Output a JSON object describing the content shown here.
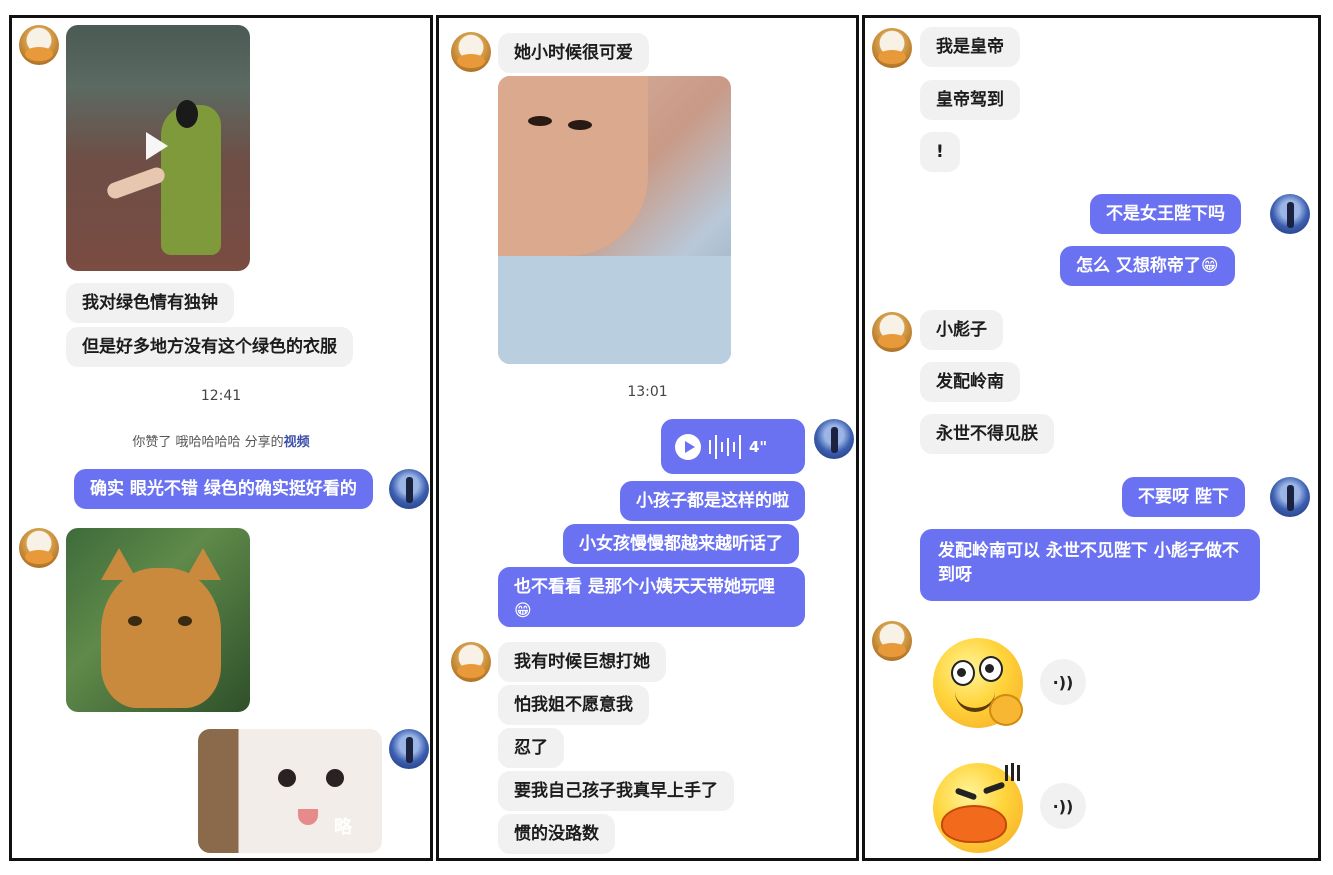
{
  "panel1": {
    "msg1": "我对绿色情有独钟",
    "msg2": "但是好多地方没有这个绿色的衣服",
    "time": "12:41",
    "sys_prefix": "你赞了 哦哈哈哈哈 分享的",
    "sys_link": "视频",
    "msg3": "确实 眼光不错 绿色的确实挺好看的",
    "sticker_text": "略"
  },
  "panel2": {
    "msg1": "她小时候很可爱",
    "time": "13:01",
    "voice_duration": "4\"",
    "msg2": "小孩子都是这样的啦",
    "msg3": "小女孩慢慢都越来越听话了",
    "msg4": "也不看看  是那个小姨天天带她玩哩",
    "msg4_emoji": "😁",
    "msg5": "我有时候巨想打她",
    "msg6": "怕我姐不愿意我",
    "msg7": "忍了",
    "msg8": "要我自己孩子我真早上手了",
    "msg9": "惯的没路数"
  },
  "panel3": {
    "msg1": "我是皇帝",
    "msg2": "皇帝驾到",
    "msg3": "!",
    "msg4": "不是女王陛下吗",
    "msg5": "怎么 又想称帝了",
    "msg5_emoji": "😁",
    "msg6": "小彪子",
    "msg7": "发配岭南",
    "msg8": "永世不得见朕",
    "msg9": "不要呀  陛下",
    "msg10": "发配岭南可以  永世不见陛下  小彪子做不到呀",
    "audio_icon": "·))"
  },
  "colors": {
    "sent": "#6b72f2",
    "received": "#f1f1f1"
  }
}
